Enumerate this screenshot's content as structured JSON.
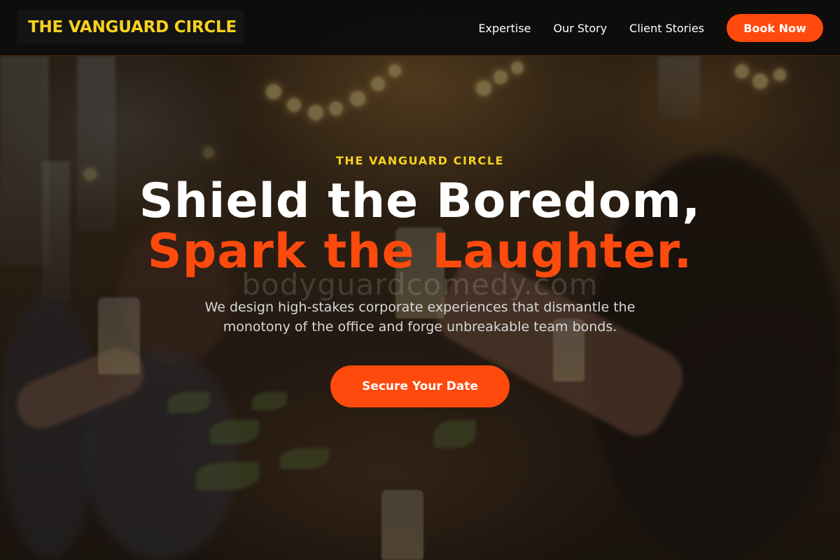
{
  "nav": {
    "logo": "THE VANGUARD CIRCLE",
    "links": [
      "Expertise",
      "Our Story",
      "Client Stories"
    ],
    "cta": "Book Now"
  },
  "hero": {
    "eyebrow": "THE VANGUARD CIRCLE",
    "headline_line1": "Shield the Boredom,",
    "headline_line2": "Spark the Laughter.",
    "watermark": "bodyguardcomedy.com",
    "subtext": "We design high-stakes corporate experiences that dismantle the monotony of the office and forge unbreakable team bonds.",
    "cta": "Secure Your Date"
  },
  "colors": {
    "accent": "#ff4a0d",
    "logo_yellow": "#f7d21e",
    "nav_bg": "#0c0c0c"
  }
}
